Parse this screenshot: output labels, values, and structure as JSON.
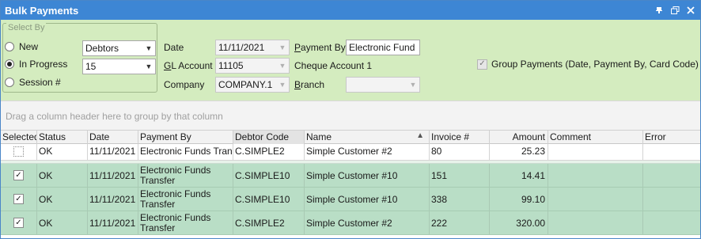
{
  "window": {
    "title": "Bulk Payments",
    "controls": {
      "pin": "↕",
      "restore": "❐",
      "close": "✕"
    }
  },
  "select_by": {
    "legend": "Select By",
    "options": [
      {
        "label": "New",
        "checked": false
      },
      {
        "label": "In Progress",
        "checked": true
      },
      {
        "label": "Session #",
        "checked": false
      }
    ],
    "debtors_combo": "Debtors",
    "progress_combo": "15"
  },
  "form": {
    "date_label": "Date",
    "date_value": "11/11/2021",
    "gl_label_underline": "G",
    "gl_label_rest": "L Account",
    "gl_value": "11105",
    "company_label": "Company",
    "company_value": "COMPANY.1",
    "payment_by_label_underline": "P",
    "payment_by_label_rest": "ayment By",
    "payment_by_value": "Electronic Fund",
    "cheque_account": "Cheque Account 1",
    "branch_label_underline": "B",
    "branch_label_rest": "ranch",
    "branch_value": "",
    "group_payments_label": "Group Payments (Date, Payment By, Card Code)",
    "group_payments_checked": true
  },
  "groupby_hint": "Drag a column header here to group by that column",
  "grid": {
    "columns": [
      "Selected",
      "Status",
      "Date",
      "Payment By",
      "Debtor Code",
      "Name",
      "Invoice #",
      "Amount",
      "Comment",
      "Error"
    ],
    "rows": [
      {
        "selected": false,
        "status": "OK",
        "date": "11/11/2021",
        "payment_by": "Electronic Funds Transfer",
        "debtor_code": "C.SIMPLE2",
        "name": "Simple Customer #2",
        "invoice": "80",
        "amount": "25.23",
        "comment": "",
        "error": ""
      },
      {
        "selected": true,
        "status": "OK",
        "date": "11/11/2021",
        "payment_by": "Electronic Funds Transfer",
        "debtor_code": "C.SIMPLE10",
        "name": "Simple Customer #10",
        "invoice": "151",
        "amount": "14.41",
        "comment": "",
        "error": ""
      },
      {
        "selected": true,
        "status": "OK",
        "date": "11/11/2021",
        "payment_by": "Electronic Funds Transfer",
        "debtor_code": "C.SIMPLE10",
        "name": "Simple Customer #10",
        "invoice": "338",
        "amount": "99.10",
        "comment": "",
        "error": ""
      },
      {
        "selected": true,
        "status": "OK",
        "date": "11/11/2021",
        "payment_by": "Electronic Funds Transfer",
        "debtor_code": "C.SIMPLE2",
        "name": "Simple Customer #2",
        "invoice": "222",
        "amount": "320.00",
        "comment": "",
        "error": ""
      }
    ]
  }
}
